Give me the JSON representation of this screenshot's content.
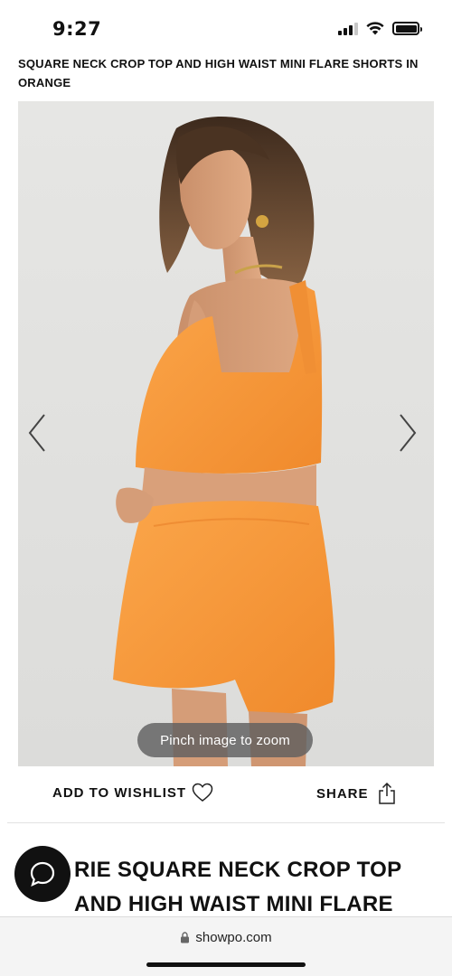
{
  "status": {
    "time": "9:27",
    "icons": [
      "cellular-signal-icon",
      "wifi-icon",
      "battery-icon"
    ]
  },
  "product": {
    "header_title": "SQUARE NECK CROP TOP AND HIGH WAIST MINI FLARE SHORTS IN ORANGE",
    "title_partial": "RIE SQUARE NECK CROP TOP AND HIGH WAIST MINI FLARE",
    "color_swatch": "#f79a3a"
  },
  "gallery": {
    "zoom_hint": "Pinch image to zoom",
    "prev_icon": "chevron-left-icon",
    "next_icon": "chevron-right-icon"
  },
  "actions": {
    "wishlist_label": "ADD TO WISHLIST",
    "wishlist_icon": "heart-icon",
    "share_label": "SHARE",
    "share_icon": "share-icon"
  },
  "chat": {
    "icon": "chat-bubble-icon"
  },
  "browser": {
    "url": "showpo.com",
    "lock_icon": "lock-icon"
  },
  "colors": {
    "background": "#ffffff",
    "text": "#111111",
    "image_bg": "#e3e3e1",
    "garment": "#f79a3a"
  }
}
